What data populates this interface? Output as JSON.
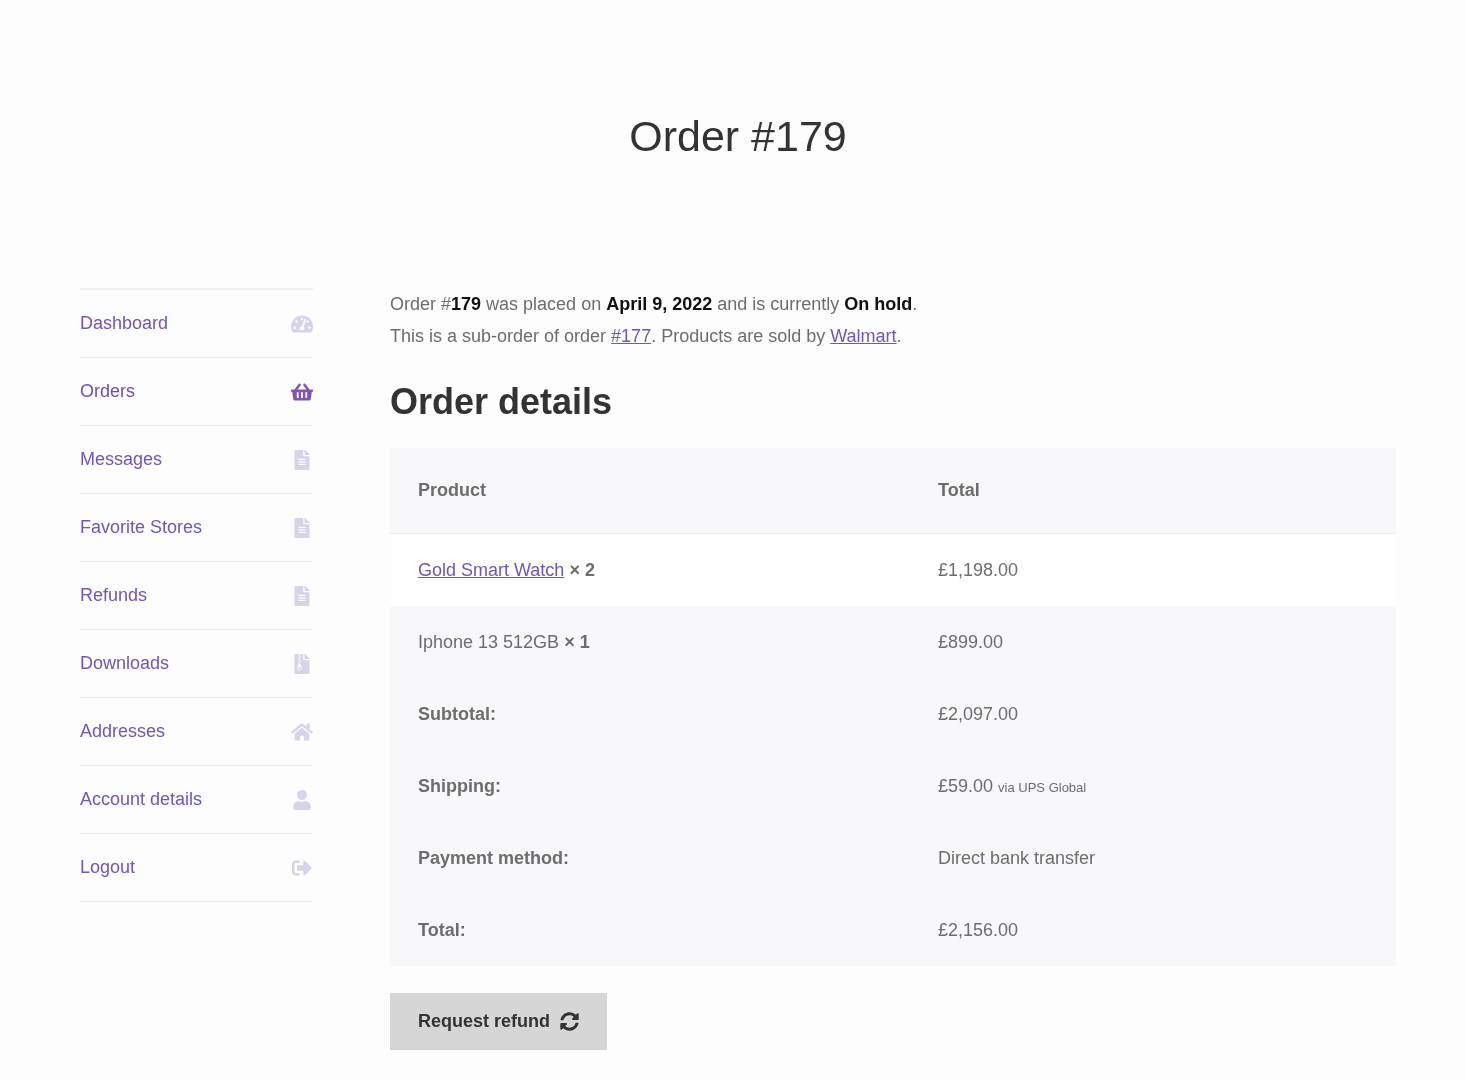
{
  "page_title": "Order #179",
  "account_nav": [
    {
      "label": "Dashboard",
      "selected": false
    },
    {
      "label": "Orders",
      "selected": true
    },
    {
      "label": "Messages",
      "selected": false
    },
    {
      "label": "Favorite Stores",
      "selected": false
    },
    {
      "label": "Refunds",
      "selected": false
    },
    {
      "label": "Downloads",
      "selected": false
    },
    {
      "label": "Addresses",
      "selected": false
    },
    {
      "label": "Account details",
      "selected": false
    },
    {
      "label": "Logout",
      "selected": false
    }
  ],
  "order_summary": {
    "status_line": "Order #**179** was placed on **April 9, 2022** and is currently **On hold**.",
    "sub_order_line": {
      "before": "This is a sub-order of order ",
      "order_link": "#177",
      "middle": ". Products are sold by ",
      "vendor_link": "Walmart",
      "after": "."
    }
  },
  "order_details": {
    "heading": "Order details",
    "columns": [
      "Product",
      "Total"
    ],
    "items": [
      {
        "name": "Gold Smart Watch",
        "linked": true,
        "quantity": "× 2",
        "total": "£1,198.00"
      },
      {
        "name": "Iphone 13 512GB",
        "linked": false,
        "quantity": "× 1",
        "total": "£899.00"
      }
    ],
    "totals": [
      {
        "label": "Subtotal:",
        "value": "£2,097.00"
      },
      {
        "label": "Shipping:",
        "value": "£59.00",
        "note": "via UPS Global"
      },
      {
        "label": "Payment method:",
        "value": "Direct bank transfer"
      },
      {
        "label": "Total:",
        "value": "£2,156.00"
      }
    ]
  },
  "refund_button": {
    "label": "Request refund"
  }
}
